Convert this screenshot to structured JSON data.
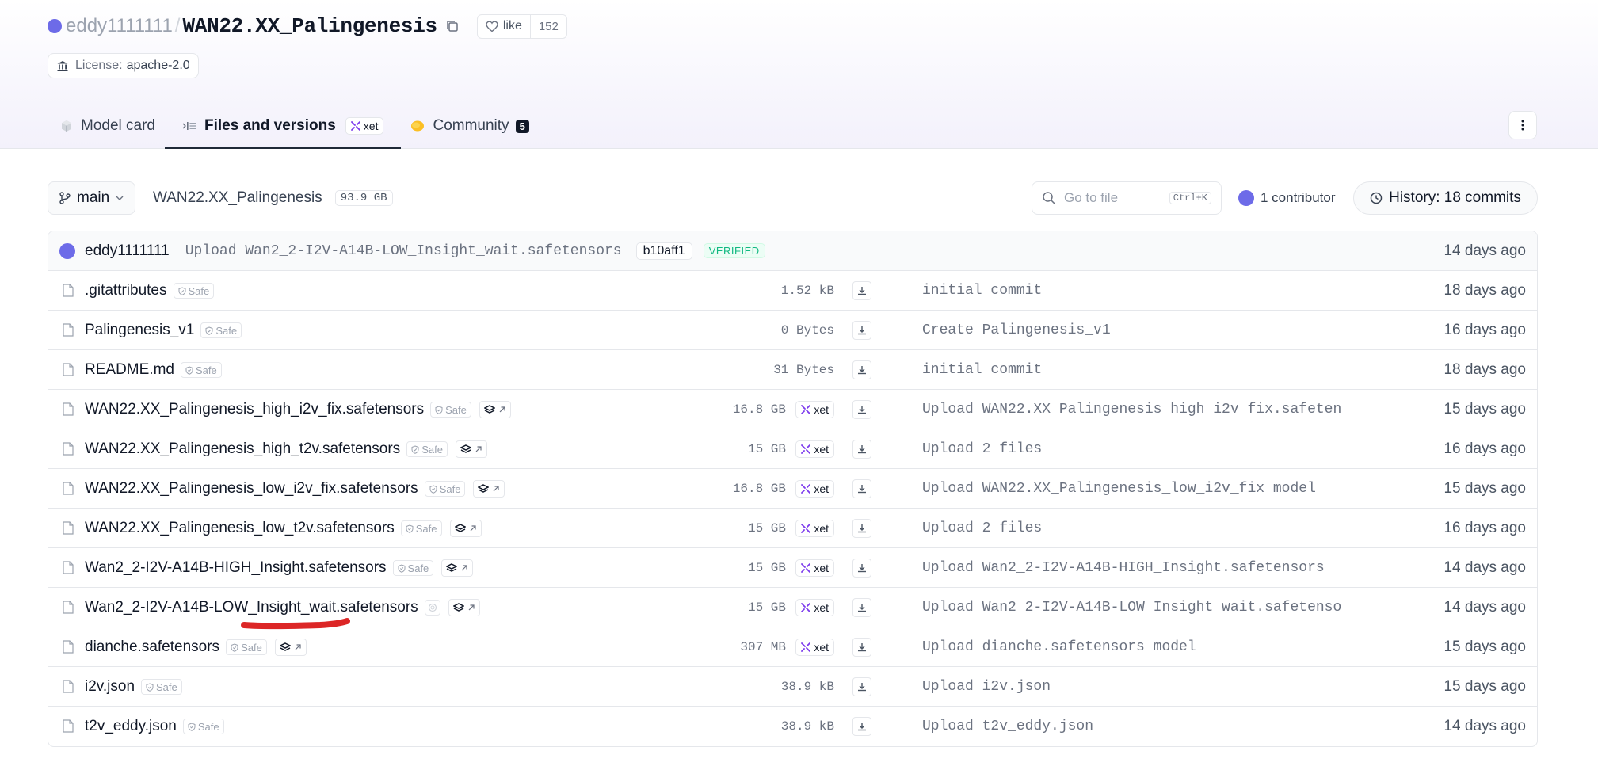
{
  "repo": {
    "owner": "eddy1111111",
    "name": "WAN22.XX_Palingenesis",
    "like_label": "like",
    "like_count": "152",
    "license_label": "License:",
    "license_value": "apache-2.0"
  },
  "tabs": [
    {
      "label": "Model card",
      "icon": "cube-icon"
    },
    {
      "label": "Files and versions",
      "icon": "files-icon",
      "tag": "xet"
    },
    {
      "label": "Community",
      "icon": "community-icon",
      "count": "5"
    }
  ],
  "toolbar": {
    "branch": "main",
    "path": "WAN22.XX_Palingenesis",
    "size": "93.9 GB",
    "search_placeholder": "Go to file",
    "shortcut": "Ctrl+K",
    "contributors": "1 contributor",
    "history": "History: 18 commits"
  },
  "last_commit": {
    "author": "eddy1111111",
    "message": "Upload Wan2_2-I2V-A14B-LOW_Insight_wait.safetensors",
    "hash": "b10aff1",
    "verified": "VERIFIED",
    "date": "14 days ago"
  },
  "files": [
    {
      "name": ".gitattributes",
      "safe": "Safe",
      "size": "1.52 kB",
      "xet": false,
      "layers": false,
      "message": "initial commit",
      "date": "18 days ago"
    },
    {
      "name": "Palingenesis_v1",
      "safe": "Safe",
      "size": "0 Bytes",
      "xet": false,
      "layers": false,
      "message": "Create Palingenesis_v1",
      "date": "16 days ago"
    },
    {
      "name": "README.md",
      "safe": "Safe",
      "size": "31 Bytes",
      "xet": false,
      "layers": false,
      "message": "initial commit",
      "date": "18 days ago"
    },
    {
      "name": "WAN22.XX_Palingenesis_high_i2v_fix.safetensors",
      "safe": "Safe",
      "size": "16.8 GB",
      "xet": true,
      "layers": true,
      "message": "Upload WAN22.XX_Palingenesis_high_i2v_fix.safeten…",
      "date": "15 days ago"
    },
    {
      "name": "WAN22.XX_Palingenesis_high_t2v.safetensors",
      "safe": "Safe",
      "size": "15 GB",
      "xet": true,
      "layers": true,
      "message": "Upload 2 files",
      "date": "16 days ago"
    },
    {
      "name": "WAN22.XX_Palingenesis_low_i2v_fix.safetensors",
      "safe": "Safe",
      "size": "16.8 GB",
      "xet": true,
      "layers": true,
      "message": "Upload WAN22.XX_Palingenesis_low_i2v_fix model",
      "date": "15 days ago"
    },
    {
      "name": "WAN22.XX_Palingenesis_low_t2v.safetensors",
      "safe": "Safe",
      "size": "15 GB",
      "xet": true,
      "layers": true,
      "message": "Upload 2 files",
      "date": "16 days ago"
    },
    {
      "name": "Wan2_2-I2V-A14B-HIGH_Insight.safetensors",
      "safe": "Safe",
      "size": "15 GB",
      "xet": true,
      "layers": true,
      "message": "Upload Wan2_2-I2V-A14B-HIGH_Insight.safetensors",
      "date": "14 days ago"
    },
    {
      "name": "Wan2_2-I2V-A14B-LOW_Insight_wait.safetensors",
      "safe": "",
      "size": "15 GB",
      "xet": true,
      "layers": true,
      "message": "Upload Wan2_2-I2V-A14B-LOW_Insight_wait.safetenso…",
      "date": "14 days ago"
    },
    {
      "name": "dianche.safetensors",
      "safe": "Safe",
      "size": "307 MB",
      "xet": true,
      "layers": true,
      "message": "Upload dianche.safetensors model",
      "date": "15 days ago"
    },
    {
      "name": "i2v.json",
      "safe": "Safe",
      "size": "38.9 kB",
      "xet": false,
      "layers": false,
      "message": "Upload i2v.json",
      "date": "15 days ago"
    },
    {
      "name": "t2v_eddy.json",
      "safe": "Safe",
      "size": "38.9 kB",
      "xet": false,
      "layers": false,
      "message": "Upload t2v_eddy.json",
      "date": "14 days ago"
    }
  ],
  "xet_label": "xet",
  "colors": {
    "avatar": "#6d6be8",
    "verified": "#10b981",
    "annotation": "#dc2626"
  }
}
